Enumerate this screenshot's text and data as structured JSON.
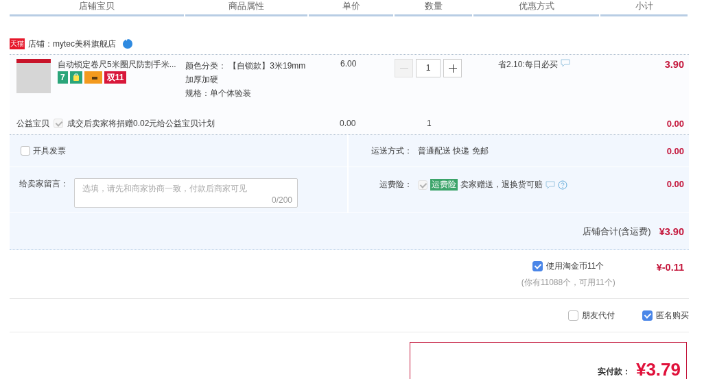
{
  "columns": [
    "店铺宝贝",
    "商品属性",
    "单价",
    "数量",
    "优惠方式",
    "小计"
  ],
  "shop": {
    "badge": "天猫",
    "name": "店铺：mytec美科旗舰店"
  },
  "item": {
    "title": "自动锁定卷尺5米圈尺防割手米...",
    "badges": [
      {
        "kind": "text",
        "label": "7",
        "color": "#2aa57a"
      },
      {
        "kind": "bag",
        "color": "#2aa57a"
      },
      {
        "kind": "card",
        "color": "#f39a1e"
      },
      {
        "kind": "text",
        "label": "双11",
        "color": "#d8173a"
      }
    ],
    "properties": [
      "颜色分类： 【自锁款】3米19mm",
      "加厚加硬",
      "规格：单个体验装"
    ],
    "price": "6.00",
    "quantity": "1",
    "minus_disabled": true,
    "promotion": "省2.10:每日必买",
    "subtotal": "3.90"
  },
  "charity": {
    "label": "公益宝贝",
    "checked": true,
    "disabled": true,
    "text": "成交后卖家将捐赠0.02元给公益宝贝计划",
    "price": "0.00",
    "quantity": "1",
    "subtotal": "0.00"
  },
  "invoice": {
    "label": "开具发票",
    "checked": false
  },
  "message": {
    "label": "给卖家留言：",
    "placeholder": "选填，请先和商家协商一致，付款后商家可见",
    "counter": "0/200"
  },
  "shipping": {
    "label": "运送方式：",
    "value": "普通配送 快递 免邮",
    "amount": "0.00"
  },
  "insurance": {
    "label": "运费险：",
    "checked": true,
    "disabled": true,
    "tag": "运费险",
    "text": "卖家赠送，退换货可赔",
    "amount": "0.00"
  },
  "shop_total": {
    "label": "店铺合计(含运费)",
    "amount": "¥3.90"
  },
  "coins": {
    "label": "使用淘金币11个",
    "checked": true,
    "note": "(你有11088个，可用11个)",
    "amount": "¥-0.11"
  },
  "options": [
    {
      "label": "朋友代付",
      "checked": false
    },
    {
      "label": "匿名购买",
      "checked": true
    }
  ],
  "payment": {
    "label": "实付款：",
    "amount": "¥3.79"
  }
}
